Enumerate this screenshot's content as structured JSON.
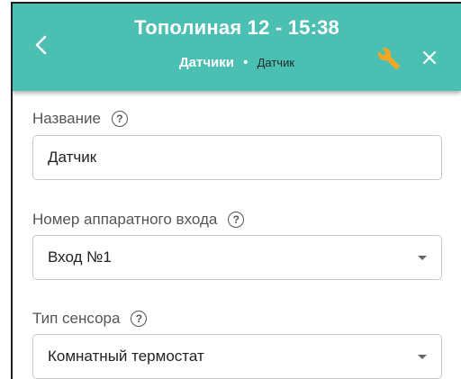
{
  "header": {
    "title": "Тополиная 12 - 15:38",
    "breadcrumb_parent": "Датчики",
    "breadcrumb_separator": "•",
    "breadcrumb_current": "Датчик",
    "back_icon": "chevron-left-icon",
    "settings_icon": "wrench-icon",
    "close_icon": "close-icon",
    "background_color": "#4cbfb3",
    "wrench_color": "#f5a623"
  },
  "form": {
    "name": {
      "label": "Название",
      "value": "Датчик"
    },
    "hardware_input": {
      "label": "Номер аппаратного входа",
      "selected": "Вход №1"
    },
    "sensor_type": {
      "label": "Тип сенсора",
      "selected": "Комнатный термостат"
    },
    "help_glyph": "?"
  }
}
